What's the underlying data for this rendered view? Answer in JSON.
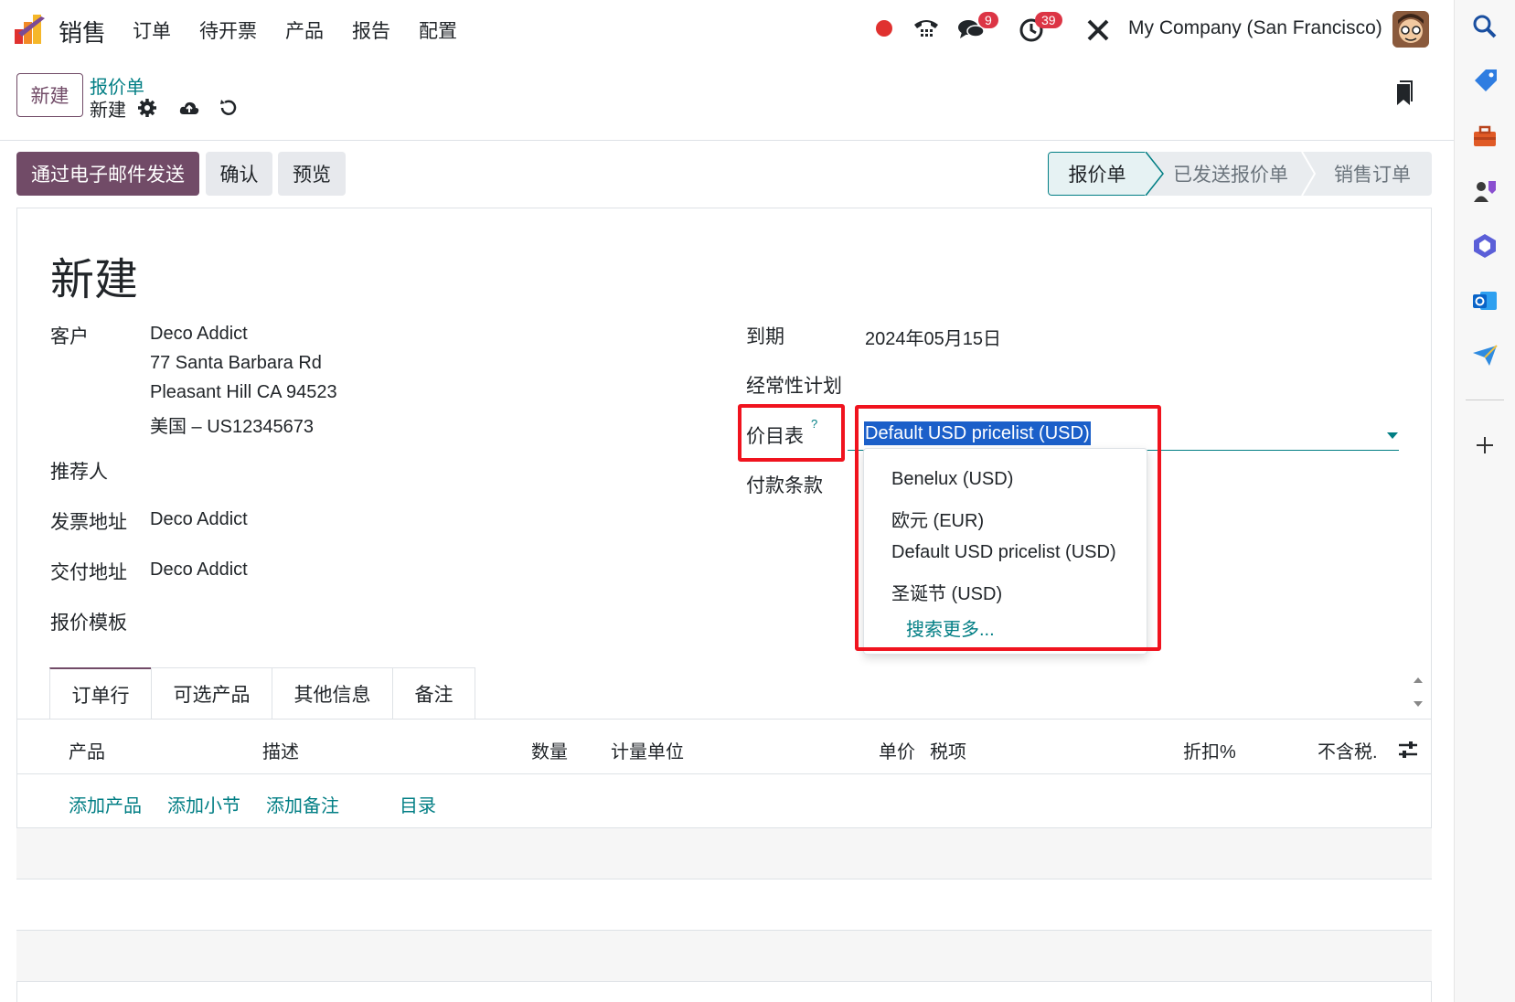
{
  "app": {
    "title": "销售"
  },
  "menu": [
    "订单",
    "待开票",
    "产品",
    "报告",
    "配置"
  ],
  "systray": {
    "chat_badge": "9",
    "activity_badge": "39",
    "company": "My Company (San Francisco)"
  },
  "control_panel": {
    "new_button": "新建",
    "breadcrumb_parent": "报价单",
    "breadcrumb_current": "新建"
  },
  "actions": {
    "send_email": "通过电子邮件发送",
    "confirm": "确认",
    "preview": "预览"
  },
  "status": {
    "stages": [
      "报价单",
      "已发送报价单",
      "销售订单"
    ],
    "active": "报价单"
  },
  "form": {
    "title": "新建",
    "customer_label": "客户",
    "customer_name": "Deco Addict",
    "customer_addr1": "77 Santa Barbara Rd",
    "customer_addr2": "Pleasant Hill CA 94523",
    "customer_addr3": "美国 – US12345673",
    "referrer_label": "推荐人",
    "invoice_addr_label": "发票地址",
    "invoice_addr_value": "Deco Addict",
    "delivery_addr_label": "交付地址",
    "delivery_addr_value": "Deco Addict",
    "template_label": "报价模板",
    "expiry_label": "到期",
    "expiry_value": "2024年05月15日",
    "recurring_label": "经常性计划",
    "pricelist_label": "价目表",
    "pricelist_help": "?",
    "pricelist_value": "Default USD pricelist (USD)",
    "payment_terms_label": "付款条款"
  },
  "pricelist_dropdown": {
    "options": [
      "Benelux (USD)",
      "欧元 (EUR)",
      "Default USD pricelist (USD)",
      "圣诞节 (USD)"
    ],
    "search_more": "搜索更多..."
  },
  "tabs": [
    "订单行",
    "可选产品",
    "其他信息",
    "备注"
  ],
  "lines_table": {
    "headers": [
      "产品",
      "描述",
      "数量",
      "计量单位",
      "单价",
      "税项",
      "折扣%",
      "不含税."
    ],
    "add_links": [
      "添加产品",
      "添加小节",
      "添加备注",
      "目录"
    ]
  },
  "colors": {
    "brand": "#714b67",
    "link": "#017e84",
    "highlight": "#f0131e",
    "selection": "#1b5fc9"
  }
}
